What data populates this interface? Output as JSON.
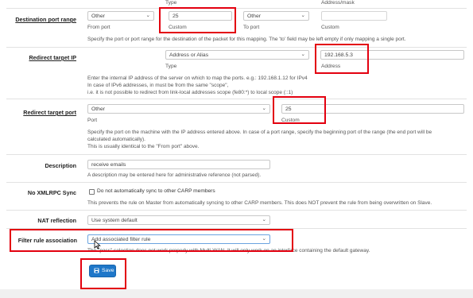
{
  "top_header": {
    "type_label": "Type",
    "address_mask_label": "Address/mask"
  },
  "destination_port_range": {
    "label": "Destination port range",
    "from_select": "Other",
    "from_value": "25",
    "from_sub": "From port",
    "custom_sub_1": "Custom",
    "to_select": "Other",
    "to_value": "",
    "to_sub": "To port",
    "custom_sub_2": "Custom",
    "help": "Specify the port or port range for the destination of the packet for this mapping. The 'to' field may be left empty if only mapping a single port."
  },
  "redirect_target_ip": {
    "label": "Redirect target IP",
    "type_select": "Address or Alias",
    "type_sub": "Type",
    "address_value": "192.168.5.3",
    "address_sub": "Address",
    "help_1": "Enter the internal IP address of the server on which to map the ports. e.g.: 192.168.1.12 for IPv4",
    "help_2": "In case of IPv6 addresses, in must be from the same \"scope\",",
    "help_3": "i.e. it is not possible to redirect from link-local addresses scope (fe80:*) to local scope (::1)"
  },
  "redirect_target_port": {
    "label": "Redirect target port",
    "port_select": "Other",
    "port_sub": "Port",
    "custom_value": "25",
    "custom_sub": "Custom",
    "help_1": "Specify the port on the machine with the IP address entered above. In case of a port range, specify the beginning port of the range (the end port will be",
    "help_2": "calculated automatically).",
    "help_3": "This is usually identical to the \"From port\" above."
  },
  "description": {
    "label": "Description",
    "value": "receive emails",
    "help": "A description may be entered here for administrative reference (not parsed)."
  },
  "no_xmlrpc_sync": {
    "label": "No XMLRPC Sync",
    "checkbox_label": "Do not automatically sync to other CARP members",
    "help": "This prevents the rule on Master from automatically syncing to other CARP members. This does NOT prevent the rule from being overwritten on Slave."
  },
  "nat_reflection": {
    "label": "NAT reflection",
    "select": "Use system default"
  },
  "filter_rule_association": {
    "label": "Filter rule association",
    "select": "Add associated filter rule",
    "help": "The \"pass\" selection does not work properly with Multi-WAN. It will only work on an interface containing the default gateway."
  },
  "save_button": {
    "label": "Save"
  },
  "colors": {
    "highlight": "#e3000f",
    "primary": "#1f77c9"
  }
}
